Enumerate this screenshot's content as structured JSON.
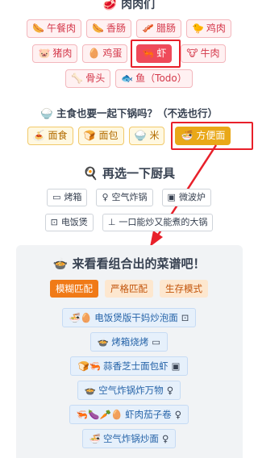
{
  "header": {
    "title": "🥩 肉肉们"
  },
  "meats": [
    {
      "emoji": "🌭",
      "label": "午餐肉"
    },
    {
      "emoji": "🌭",
      "label": "香肠"
    },
    {
      "emoji": "🥓",
      "label": "腊肠"
    },
    {
      "emoji": "🐤",
      "label": "鸡肉"
    },
    {
      "emoji": "🐷",
      "label": "猪肉"
    },
    {
      "emoji": "🥚",
      "label": "鸡蛋"
    },
    {
      "emoji": "🦐",
      "label": "虾"
    },
    {
      "emoji": "🐮",
      "label": "牛肉"
    },
    {
      "emoji": "🦴",
      "label": "骨头"
    },
    {
      "emoji": "🐟",
      "label": "鱼（Todo）"
    }
  ],
  "staples_title": "🍚 主食也要一起下锅吗？（不选也行）",
  "staples": [
    {
      "emoji": "🍝",
      "label": "面食"
    },
    {
      "emoji": "🍞",
      "label": "面包"
    },
    {
      "emoji": "🍚",
      "label": "米"
    },
    {
      "emoji": "🍜",
      "label": "方便面"
    }
  ],
  "tools_title": "🍳 再选一下厨具",
  "tools": [
    {
      "emoji": "▭",
      "label": "烤箱"
    },
    {
      "emoji": "♀",
      "label": "空气炸锅"
    },
    {
      "emoji": "▣",
      "label": "微波炉"
    },
    {
      "emoji": "⊡",
      "label": "电饭煲"
    },
    {
      "emoji": "⊥",
      "label": "一口能炒又能煮的大锅"
    }
  ],
  "combo_title": "🍲 来看看组合出的菜谱吧！",
  "modes": [
    "模糊匹配",
    "严格匹配",
    "生存模式"
  ],
  "recipes": [
    {
      "emojis": "🍜🥚",
      "label": "电饭煲版干妈炒泡面",
      "tool": "⊡"
    },
    {
      "emojis": "🍲",
      "label": "烤箱烧烤",
      "tool": "▭"
    },
    {
      "emojis": "🍞🦐",
      "label": "蒜香芝士面包虾",
      "tool": "▣"
    },
    {
      "emojis": "🍲",
      "label": "空气炸锅炸万物",
      "tool": "♀"
    },
    {
      "emojis": "🦐🍆🥕🥚",
      "label": "虾肉茄子卷",
      "tool": "♀"
    },
    {
      "emojis": "🍜",
      "label": "空气炸锅炒面",
      "tool": "♀"
    }
  ]
}
